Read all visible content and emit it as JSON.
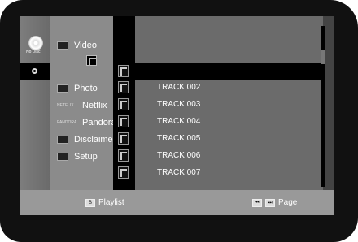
{
  "menu": {
    "top_item": "Video",
    "disc_label": "No Disc",
    "items": [
      {
        "label": "Photo",
        "icon": "photo-icon"
      },
      {
        "label": "Netflix",
        "icon": "netflix-logo"
      },
      {
        "label": "Pandora",
        "icon": "pandora-logo"
      },
      {
        "label": "Disclaimer",
        "icon": "document-icon"
      },
      {
        "label": "Setup",
        "icon": "gear-icon"
      }
    ]
  },
  "tracks": {
    "items": [
      "TRACK 002",
      "TRACK 003",
      "TRACK 004",
      "TRACK 005",
      "TRACK 006",
      "TRACK 007"
    ]
  },
  "bottom": {
    "playlist_key": "B",
    "playlist_label": "Playlist",
    "page_label": "Page"
  },
  "branding": {
    "netflix_text": "NETFLIX",
    "pandora_text": "PANDORA"
  }
}
